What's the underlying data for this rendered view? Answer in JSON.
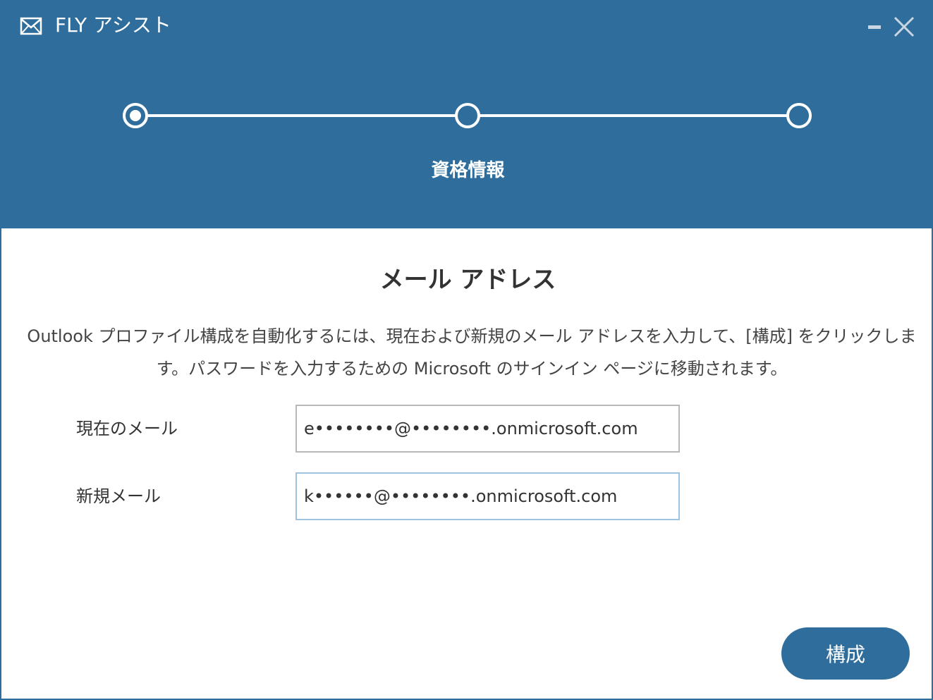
{
  "window": {
    "title": "FLY アシスト",
    "app_icon": "envelope-icon",
    "minimize_icon": "minimize-icon",
    "close_icon": "close-icon"
  },
  "stepper": {
    "steps": [
      {
        "state": "active"
      },
      {
        "state": "inactive"
      },
      {
        "state": "inactive"
      }
    ],
    "current_label": "資格情報"
  },
  "form": {
    "title": "メール アドレス",
    "description": "Outlook プロファイル構成を自動化するには、現在および新規のメール アドレスを入力して、[構成] をクリックします。パスワードを入力するための Microsoft のサインイン ページに移動されます。",
    "current_email": {
      "label": "現在のメール",
      "value": "e••••••••@••••••••.onmicrosoft.com"
    },
    "new_email": {
      "label": "新規メール",
      "value": "k••••••@••••••••.onmicrosoft.com"
    },
    "submit_label": "構成"
  },
  "colors": {
    "accent": "#2f6e9c",
    "text": "#333333"
  }
}
